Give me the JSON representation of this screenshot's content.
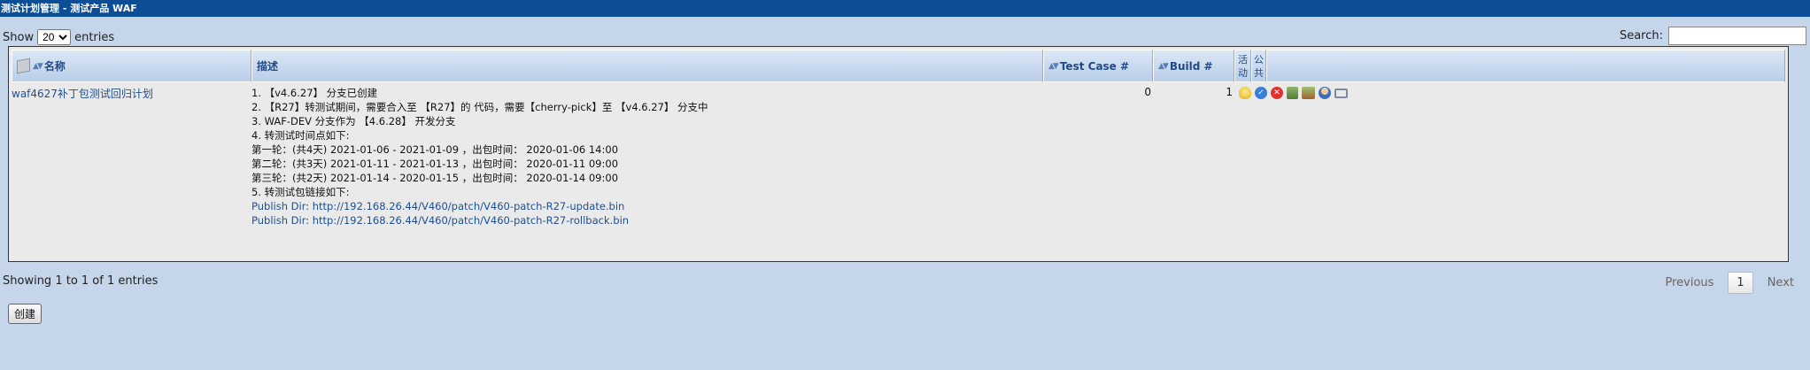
{
  "header": {
    "title": "测试计划管理 - 测试产品 WAF"
  },
  "controls": {
    "show_label": "Show",
    "entries_label": "entries",
    "page_size": "20",
    "search_label": "Search:",
    "search_value": ""
  },
  "columns": {
    "name": "名称",
    "desc": "描述",
    "testcase": "Test Case #",
    "build": "Build #",
    "active_1": "活",
    "active_2": "动",
    "public_1": "公",
    "public_2": "共"
  },
  "row": {
    "name": "waf4627补丁包测试回归计划",
    "desc_lines": [
      "1. 【v4.6.27】 分支已创建",
      "2. 【R27】转测试期间，需要合入至 【R27】的 代码，需要【cherry-pick】至 【v4.6.27】 分支中",
      "3. WAF-DEV 分支作为 【4.6.28】 开发分支",
      "4. 转测试时间点如下:",
      "第一轮：(共4天) 2021-01-06 - 2021-01-09 ，出包时间： 2020-01-06 14:00",
      "第二轮：(共3天) 2021-01-11 - 2021-01-13 ，出包时间： 2020-01-11 09:00",
      "第三轮：(共2天) 2021-01-14 - 2020-01-15 ，出包时间： 2020-01-14 09:00",
      "5. 转测试包链接如下:"
    ],
    "links": [
      "Publish Dir: http://192.168.26.44/V460/patch/V460-patch-R27-update.bin",
      "Publish Dir: http://192.168.26.44/V460/patch/V460-patch-R27-rollback.bin"
    ],
    "testcase_count": "0",
    "build_count": "1",
    "action_icons": [
      "bulb-icon",
      "check-icon",
      "delete-icon",
      "document-icon",
      "report-icon",
      "user-icon",
      "assign-icon"
    ]
  },
  "footer": {
    "info": "Showing 1 to 1 of 1 entries",
    "previous": "Previous",
    "current_page": "1",
    "next": "Next",
    "create_label": "创建"
  },
  "colors": {
    "titlebar": "#0c4e96",
    "background": "#c5d5ea",
    "header_text": "#224a86"
  }
}
